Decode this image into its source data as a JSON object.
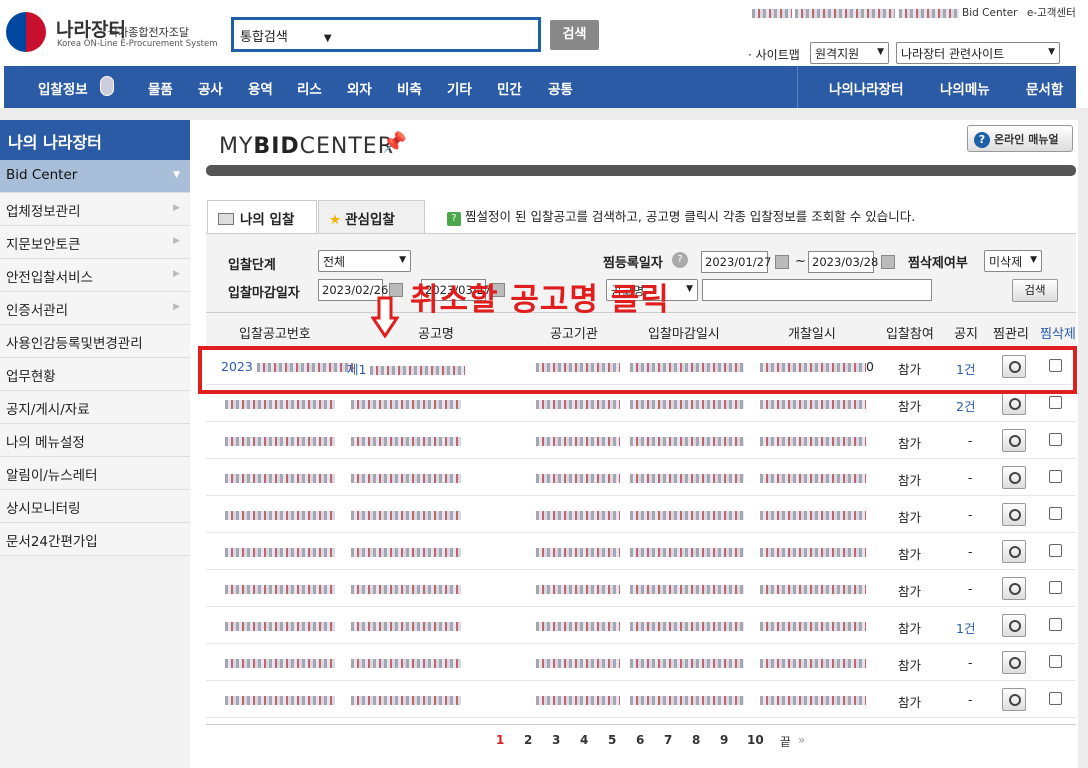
{
  "header": {
    "logo_title": "나라장터",
    "logo_subtitle": "국가종합전자조달",
    "logo_en": "Korea ON-Line E-Procurement System",
    "search_select": "통합검색",
    "search_button": "검색",
    "toplinks": [
      "Bid Center",
      "e-고객센터"
    ],
    "sitemap": "· 사이트맵",
    "remote_support": "원격지원",
    "related_sites": "나라장터 관련사이트"
  },
  "nav": {
    "items": [
      "입찰정보",
      "물품",
      "공사",
      "용역",
      "리스",
      "외자",
      "비축",
      "기타",
      "민간",
      "공통"
    ],
    "right_items": [
      "나의나라장터",
      "나의메뉴",
      "문서함"
    ]
  },
  "sidebar": {
    "title": "나의 나라장터",
    "items": [
      {
        "label": "Bid Center",
        "active": true
      },
      {
        "label": "업체정보관리"
      },
      {
        "label": "지문보안토큰"
      },
      {
        "label": "안전입찰서비스"
      },
      {
        "label": "인증서관리"
      },
      {
        "label": "사용인감등록및변경관리"
      },
      {
        "label": "업무현황"
      },
      {
        "label": "공지/게시/자료"
      },
      {
        "label": "나의 메뉴설정"
      },
      {
        "label": "알림이/뉴스레터"
      },
      {
        "label": "상시모니터링"
      },
      {
        "label": "문서24간편가입"
      }
    ]
  },
  "main": {
    "brand_prefix": "MY",
    "brand_bold": "BID",
    "brand_suffix": "CENTER",
    "manual_button": "온라인 매뉴얼",
    "tabs": [
      "나의 입찰",
      "관심입찰"
    ],
    "hint": "찜설정이 된 입찰공고를 검색하고, 공고명 클릭시 각종 입찰정보를 조회할 수 있습니다.",
    "filter": {
      "stage_label": "입찰단계",
      "stage_value": "전체",
      "reg_date_label": "찜등록일자",
      "reg_from": "2023/01/27",
      "reg_to": "2023/03/28",
      "tilde": "~",
      "delete_label": "찜삭제여부",
      "delete_value": "미삭제",
      "deadline_label": "입찰마감일자",
      "deadline_from": "2023/02/26",
      "deadline_to": "2023/03/27",
      "name_select": "공고명",
      "search_button": "검색"
    },
    "annotation": "취소할 공고명 클릭",
    "table": {
      "headers": [
        "입찰공고번호",
        "공고명",
        "공고기관",
        "입찰마감일시",
        "개찰일시",
        "입찰참여",
        "공지",
        "찜관리",
        "찜삭제"
      ],
      "rows": [
        {
          "no": "2023",
          "name": "제1",
          "agency": "",
          "deadline": "",
          "open": "0",
          "join": "참가",
          "notice": "1건"
        },
        {
          "no": "",
          "name": "",
          "agency": "",
          "deadline": "",
          "open": "",
          "join": "참가",
          "notice": "2건"
        },
        {
          "no": "",
          "name": "",
          "agency": "",
          "deadline": "",
          "open": "",
          "join": "참가",
          "notice": "-"
        },
        {
          "no": "",
          "name": "",
          "agency": "",
          "deadline": "",
          "open": "",
          "join": "참가",
          "notice": "-"
        },
        {
          "no": "",
          "name": "",
          "agency": "",
          "deadline": "",
          "open": "",
          "join": "참가",
          "notice": "-"
        },
        {
          "no": "",
          "name": "",
          "agency": "",
          "deadline": "",
          "open": "",
          "join": "참가",
          "notice": "-"
        },
        {
          "no": "",
          "name": "",
          "agency": "",
          "deadline": "",
          "open": "",
          "join": "참가",
          "notice": "-"
        },
        {
          "no": "",
          "name": "",
          "agency": "",
          "deadline": "",
          "open": "",
          "join": "참가",
          "notice": "1건"
        },
        {
          "no": "",
          "name": "",
          "agency": "",
          "deadline": "",
          "open": "",
          "join": "참가",
          "notice": "-"
        },
        {
          "no": "",
          "name": "",
          "agency": "",
          "deadline": "",
          "open": "",
          "join": "참가",
          "notice": "-"
        }
      ]
    },
    "pager": {
      "pages": [
        "1",
        "2",
        "3",
        "4",
        "5",
        "6",
        "7",
        "8",
        "9",
        "10"
      ],
      "current": "1",
      "end": "끝"
    }
  },
  "colors": {
    "nav": "#2c5ba5",
    "annotation": "#e01e1e",
    "link": "#2a5db0"
  }
}
